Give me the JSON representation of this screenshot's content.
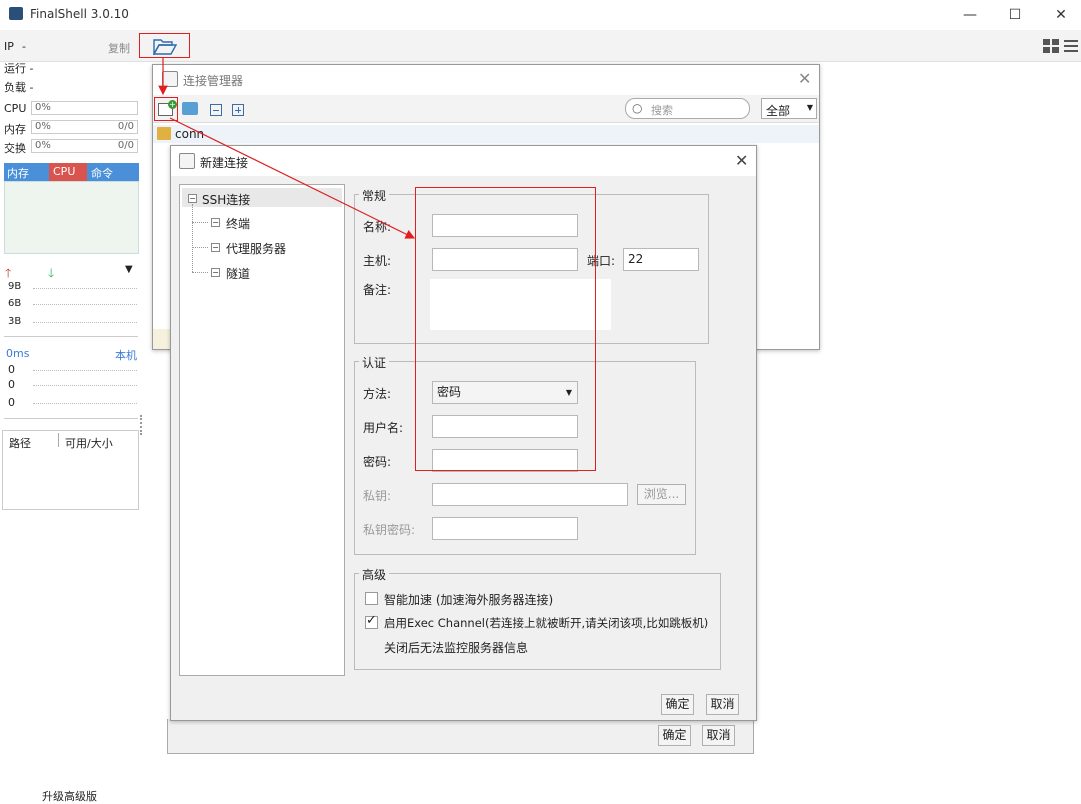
{
  "window": {
    "title": "FinalShell 3.0.10",
    "min": "—",
    "max": "☐",
    "close": "✕"
  },
  "left": {
    "ip_label": "IP",
    "ip_value": "-",
    "copy": "复制",
    "run_label": "运行 -",
    "load_label": "负载 -",
    "cpu_label": "CPU",
    "cpu_value": "0%",
    "mem_label": "内存",
    "mem_value": "0%",
    "mem_right": "0/0",
    "swap_label": "交换",
    "swap_value": "0%",
    "swap_right": "0/0",
    "tabs": [
      "内存",
      "CPU",
      "命令"
    ],
    "net": [
      "9B",
      "6B",
      "3B"
    ],
    "ping_ms": "0ms",
    "ping_host": "本机",
    "ping_vals": [
      "0",
      "0",
      "0"
    ],
    "disk_col1": "路径",
    "disk_col2": "可用/大小",
    "upgrade": "升级高级版"
  },
  "conn_manager": {
    "title": "连接管理器",
    "search_placeholder": "搜索",
    "filter": "全部",
    "folder": "conn",
    "ok": "确定",
    "cancel": "取消"
  },
  "dialog": {
    "title": "新建连接",
    "tree": {
      "root": "SSH连接",
      "children": [
        "终端",
        "代理服务器",
        "隧道"
      ]
    },
    "general": {
      "label": "常规",
      "name_label": "名称:",
      "host_label": "主机:",
      "port_label": "端口:",
      "port_value": "22",
      "note_label": "备注:"
    },
    "auth": {
      "label": "认证",
      "method_label": "方法:",
      "method_value": "密码",
      "user_label": "用户名:",
      "pass_label": "密码:",
      "key_label": "私钥:",
      "browse": "浏览...",
      "keypass_label": "私钥密码:"
    },
    "advanced": {
      "label": "高级",
      "accel_label": "智能加速 (加速海外服务器连接)",
      "accel_checked": false,
      "exec_label": "启用Exec Channel(若连接上就被断开,请关闭该项,比如跳板机)",
      "exec_checked": true,
      "exec_note": "关闭后无法监控服务器信息"
    },
    "ok": "确定",
    "cancel": "取消"
  },
  "colors": {
    "accent": "#4a90d9",
    "cpu_tab": "#d9534f",
    "annotation": "#e02020"
  }
}
